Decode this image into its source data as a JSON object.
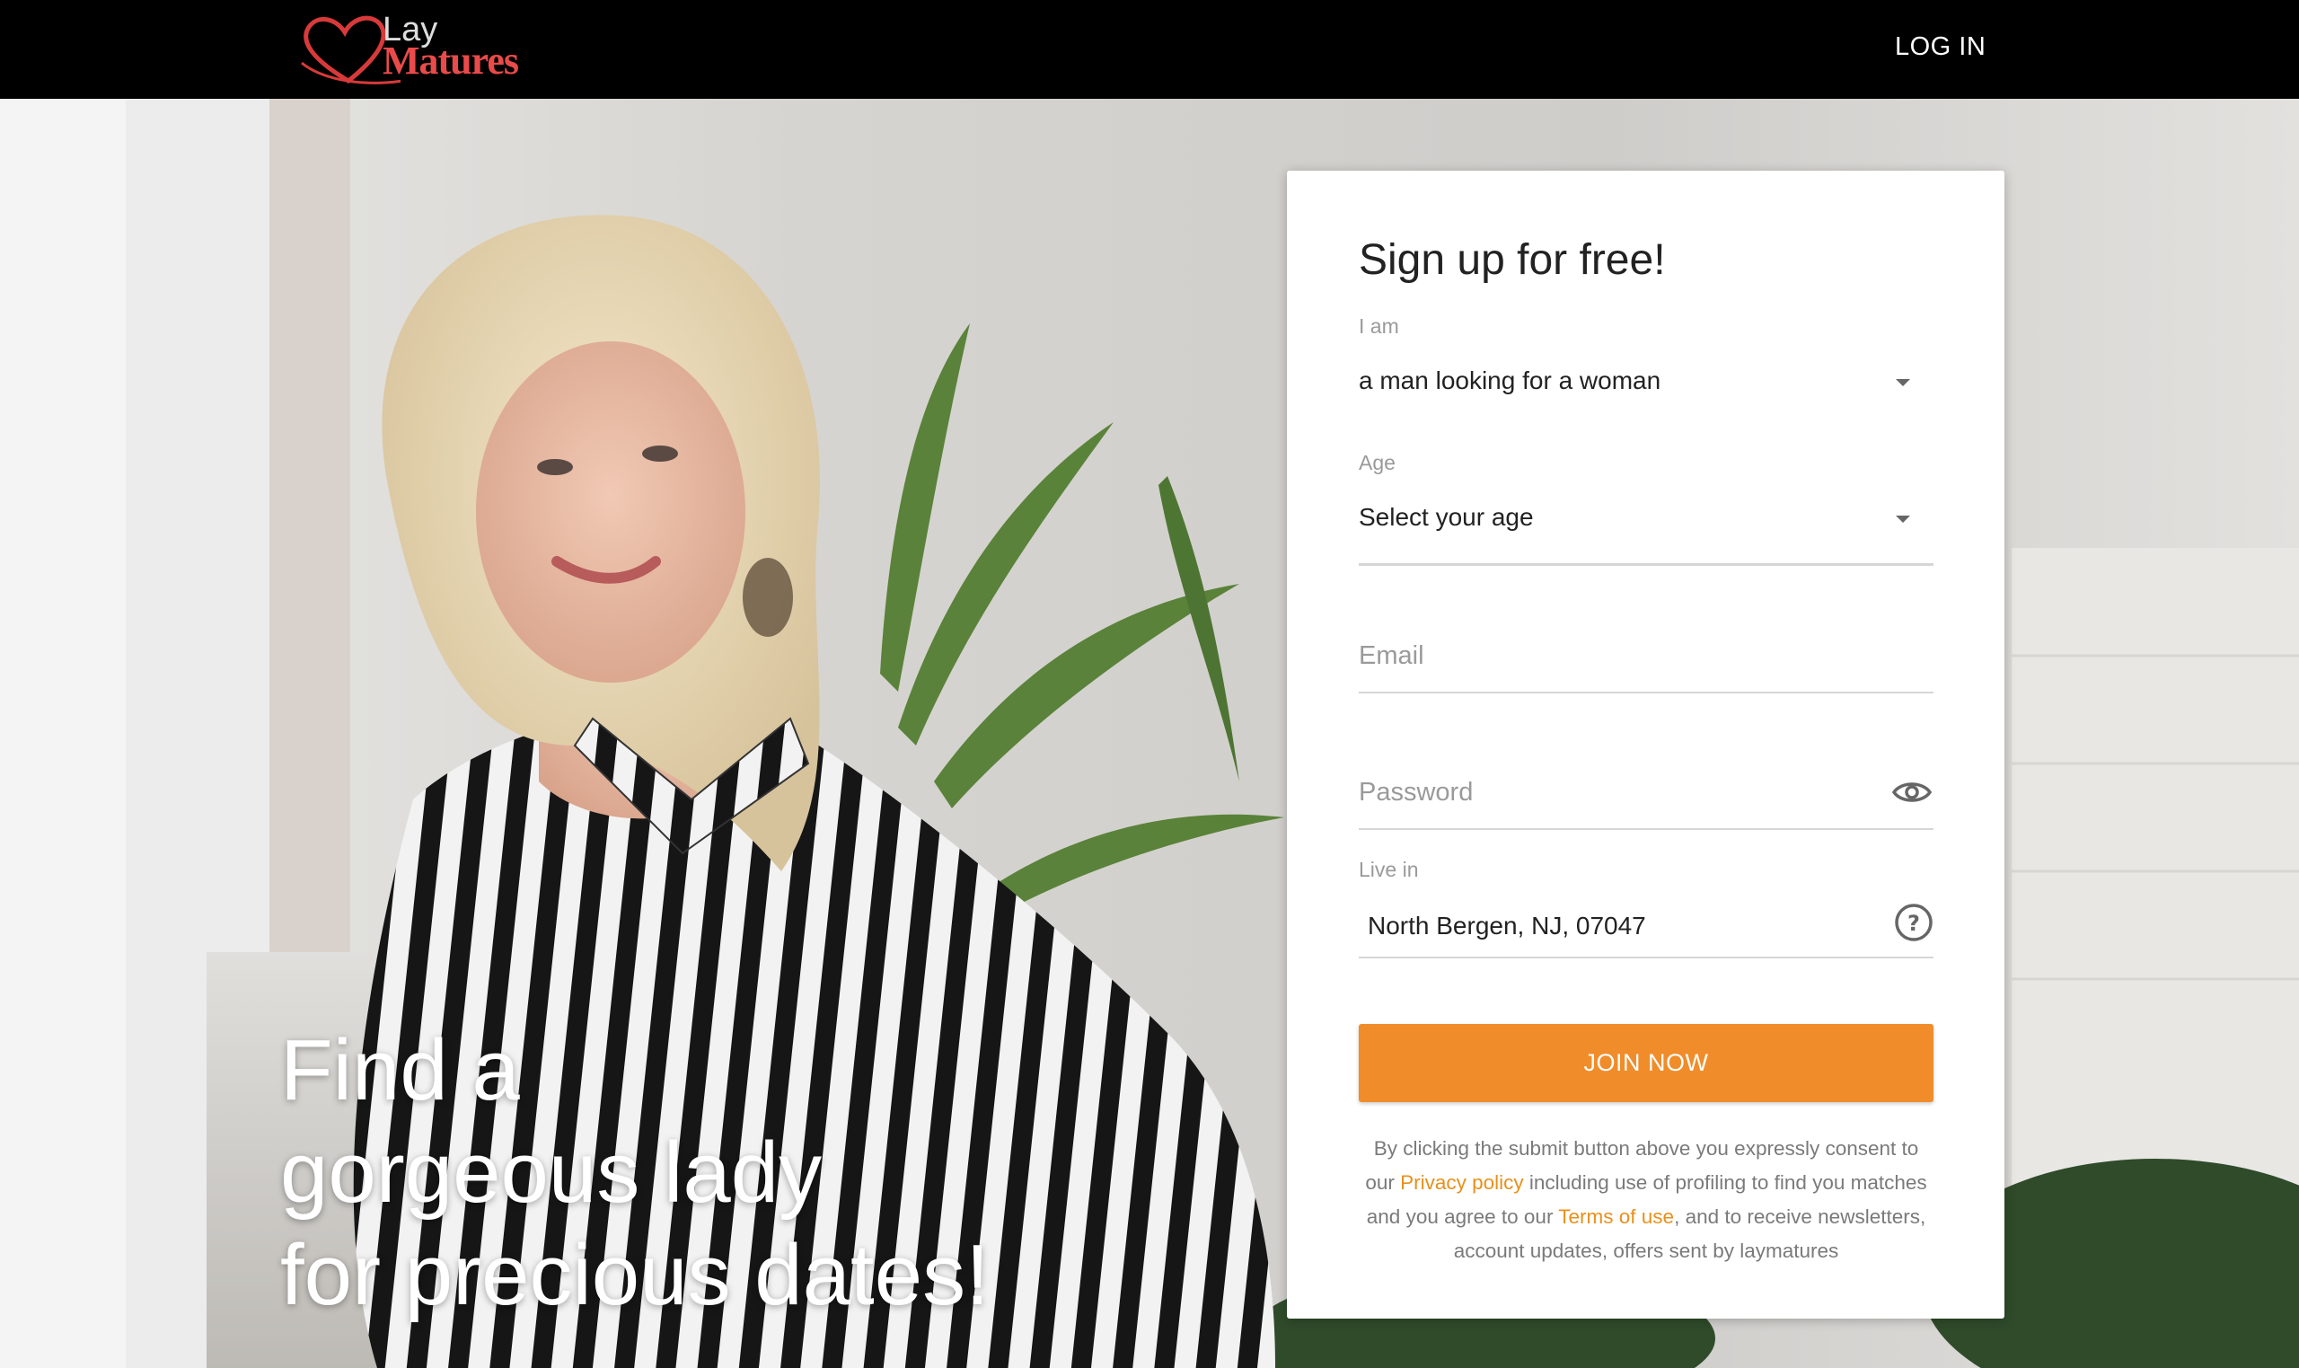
{
  "header": {
    "logo_top": "Lay",
    "logo_bottom": "Matures",
    "login_label": "LOG IN"
  },
  "hero": {
    "headline_lines": [
      "Find a",
      "gorgeous lady",
      "for precious dates!"
    ]
  },
  "signup": {
    "title": "Sign up for free!",
    "iam": {
      "label": "I am",
      "value": "a man looking for a woman"
    },
    "age": {
      "label": "Age",
      "value": "Select your age"
    },
    "email": {
      "placeholder": "Email"
    },
    "password": {
      "placeholder": "Password"
    },
    "live_in": {
      "label": "Live in",
      "value": "North Bergen, NJ, 07047"
    },
    "join_label": "JOIN NOW",
    "legal": {
      "part1": "By clicking the submit button above you expressly consent to our ",
      "privacy_link": "Privacy policy",
      "part2": " including use of profiling to find you matches and you agree to our ",
      "terms_link": "Terms of use",
      "part3": ", and to receive newsletters, account updates, offers sent by laymatures"
    }
  },
  "colors": {
    "accent_orange": "#f08c2a",
    "link_orange": "#e8901b",
    "logo_red": "#e94a4a",
    "topbar": "#000000"
  },
  "icons": {
    "eye": "eye-icon",
    "help": "question-circle-icon",
    "dropdown": "chevron-down-icon",
    "logo": "heart-logo-icon"
  }
}
